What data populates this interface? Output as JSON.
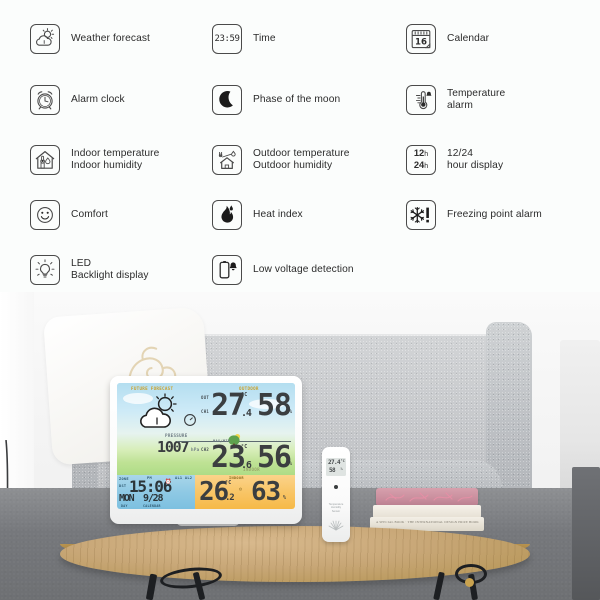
{
  "features": {
    "rows": [
      [
        {
          "icon": "weather-forecast-icon",
          "label": "Weather forecast"
        },
        {
          "icon": "time-digital-icon",
          "label": "Time",
          "icon_text": "23:59"
        },
        {
          "icon": "calendar-icon",
          "label": "Calendar",
          "icon_text": "16"
        }
      ],
      [
        {
          "icon": "alarm-clock-icon",
          "label": "Alarm clock"
        },
        {
          "icon": "moon-phase-icon",
          "label": "Phase of the moon"
        },
        {
          "icon": "temperature-alarm-icon",
          "label": "Temperature\nalarm"
        }
      ],
      [
        {
          "icon": "indoor-house-icon",
          "label": "Indoor temperature\nIndoor humidity"
        },
        {
          "icon": "outdoor-house-icon",
          "label": "Outdoor temperature\nOutdoor humidity"
        },
        {
          "icon": "hour-format-icon",
          "label": "12/24\nhour display",
          "icon_text_top": "12",
          "icon_text_top_unit": "h",
          "icon_text_bottom": "24",
          "icon_text_bottom_unit": "h"
        }
      ],
      [
        {
          "icon": "comfort-smiley-icon",
          "label": "Comfort"
        },
        {
          "icon": "heat-index-flame-icon",
          "label": "Heat index"
        },
        {
          "icon": "freezing-point-alarm-icon",
          "label": "Freezing point alarm"
        }
      ],
      [
        {
          "icon": "led-bulb-icon",
          "label": "LED\nBacklight display"
        },
        {
          "icon": "low-voltage-battery-icon",
          "label": "Low voltage detection"
        },
        {
          "icon": "",
          "label": ""
        }
      ]
    ]
  },
  "photo": {
    "alt_name": "living-room-product-photo",
    "station": {
      "label_forecast": "FUTURE FORECAST",
      "label_outdoor": "OUTDOOR",
      "label_indoor": "INDOOR",
      "label_indoor_small": "INDOOR",
      "pressure_value": "1007",
      "pressure_unit": "hPa",
      "pressure_label": "PRESSURE",
      "outdoor_temp": "27",
      "outdoor_temp_dec": ".4",
      "outdoor_temp_unit": "°C",
      "outdoor_hum": "58",
      "outdoor_hum_unit": "%",
      "channel_temp": "23",
      "channel_temp_dec": ".6",
      "channel_temp_unit": "°C",
      "channel_hum": "56",
      "channel_hum_unit": "%",
      "channel_label": "MAX/MIN",
      "indoor_temp": "26",
      "indoor_temp_dec": ".2",
      "indoor_temp_unit": "°C",
      "indoor_hum": "63",
      "indoor_hum_unit": "%",
      "clock_time": "15:06",
      "clock_meridiem": "PM",
      "clock_label_left_top": "ZONE",
      "clock_label_left_bottom": "DST",
      "clock_label_dst": "DST",
      "day_of_week": "MON",
      "day_label": "DAY",
      "date_value": "9/28",
      "date_label": "CALENDAR",
      "alarm_icons": "AL1 AL2",
      "in_label": "IN",
      "out_label": "OUT"
    },
    "sensor": {
      "temp": "27.4",
      "temp_unit": "°C",
      "hum": "58",
      "hum_unit": "%",
      "caption": "Temperature\nHumidity\nSensor"
    },
    "book_text": "A SPECIAL BOOK · THE INTERNATIONAL DESIGN PRIZE BOOK IX"
  },
  "colors": {
    "page_bg": "#fbfcfb",
    "icon_stroke": "#4a4a4a",
    "text": "#2b2b2b",
    "lcd_sky": "#b4def0",
    "lcd_grass": "#aedc86",
    "panel_blue": "#8fc9e4",
    "panel_orange": "#f8c464",
    "lcd_digit": "#3b3e40"
  }
}
